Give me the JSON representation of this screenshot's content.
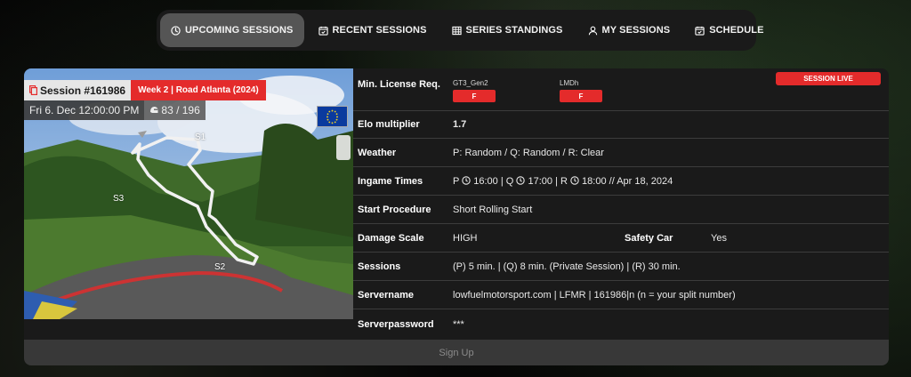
{
  "nav": {
    "tabs": [
      {
        "label": "UPCOMING SESSIONS",
        "icon": "clock-icon",
        "active": true
      },
      {
        "label": "RECENT SESSIONS",
        "icon": "calendar-check-icon",
        "active": false
      },
      {
        "label": "SERIES STANDINGS",
        "icon": "table-icon",
        "active": false
      },
      {
        "label": "MY SESSIONS",
        "icon": "user-icon",
        "active": false
      },
      {
        "label": "SCHEDULE",
        "icon": "calendar-check-icon",
        "active": false
      }
    ]
  },
  "session": {
    "id_label": "Session #161986",
    "week_label": "Week 2 | Road Atlanta (2024)",
    "date": "Fri 6. Dec 12:00:00 PM",
    "slots": "83 / 196",
    "sectors": [
      "S1",
      "S2",
      "S3"
    ]
  },
  "info": {
    "license": {
      "label": "Min. License Req.",
      "classes": [
        {
          "name": "GT3_Gen2",
          "grade": "F"
        },
        {
          "name": "LMDh",
          "grade": "F"
        }
      ],
      "status": "SESSION LIVE"
    },
    "elo": {
      "label": "Elo multiplier",
      "value": "1.7"
    },
    "weather": {
      "label": "Weather",
      "value": "P: Random / Q: Random / R: Clear"
    },
    "ingame_times": {
      "label": "Ingame Times",
      "p_prefix": "P",
      "p_time": "16:00",
      "q_prefix": "| Q",
      "q_time": "17:00",
      "r_prefix": "| R",
      "r_time": "18:00",
      "date_suffix": "// Apr 18, 2024"
    },
    "start_procedure": {
      "label": "Start Procedure",
      "value": "Short Rolling Start"
    },
    "damage": {
      "label": "Damage Scale",
      "value": "HIGH"
    },
    "safety_car": {
      "label": "Safety Car",
      "value": "Yes"
    },
    "sessions": {
      "label": "Sessions",
      "value": "(P) 5 min. | (Q) 8 min. (Private Session) | (R) 30 min."
    },
    "servername": {
      "label": "Servername",
      "value": "lowfuelmotorsport.com | LFMR | 161986|n (n = your split number)"
    },
    "serverpassword": {
      "label": "Serverpassword",
      "value": "***"
    }
  },
  "signup": {
    "label": "Sign Up"
  },
  "colors": {
    "accent_red": "#e42b2b",
    "active_tab": "#555555",
    "panel": "#1a1a1a"
  }
}
